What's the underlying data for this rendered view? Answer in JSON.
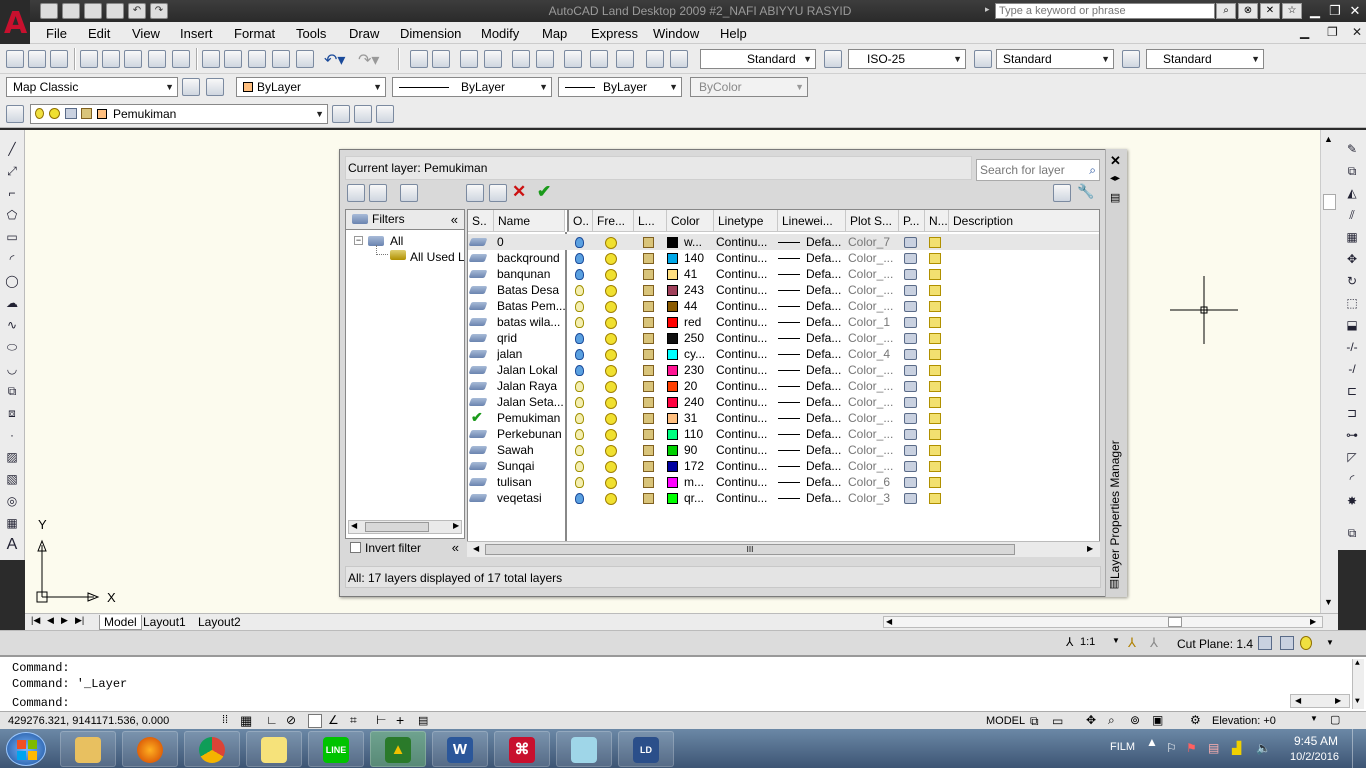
{
  "window": {
    "title": "AutoCAD Land Desktop 2009 #2_NAFI ABIYYU RASYID",
    "search_placeholder": "Type a keyword or phrase"
  },
  "menu": [
    "File",
    "Edit",
    "View",
    "Insert",
    "Format",
    "Tools",
    "Draw",
    "Dimension",
    "Modify",
    "Map",
    "Express",
    "Window",
    "Help"
  ],
  "toolbar": {
    "text_style": "Standard",
    "dim_style": "ISO-25",
    "table_style": "Standard",
    "multileader_style": "Standard",
    "workspace": "Map Classic",
    "color": "ByLayer",
    "linetype": "ByLayer",
    "lineweight": "ByLayer",
    "plotstyle": "ByColor",
    "layer": "Pemukiman"
  },
  "layer_manager": {
    "current_layer": "Current layer: Pemukiman",
    "search_placeholder": "Search for layer",
    "side_title": "Layer Properties Manager",
    "filters_label": "Filters",
    "filter_tree": [
      "All",
      "All Used L"
    ],
    "invert_filter": "Invert filter",
    "columns": [
      "S..",
      "Name",
      "O..",
      "Fre...",
      "L...",
      "Color",
      "Linetype",
      "Linewei...",
      "Plot S...",
      "P...",
      "N...",
      "Description"
    ],
    "status": "All: 17 layers displayed of 17 total layers",
    "layers": [
      {
        "name": "0",
        "on": true,
        "color_hex": "#000000",
        "color_label": "w...",
        "linetype": "Continu...",
        "lineweight": "Defa...",
        "plot_style": "Color_7",
        "current": false
      },
      {
        "name": "backqround",
        "on": true,
        "color_hex": "#00a8e8",
        "color_label": "140",
        "linetype": "Continu...",
        "lineweight": "Defa...",
        "plot_style": "Color_...",
        "current": false
      },
      {
        "name": "banqunan",
        "on": true,
        "color_hex": "#ffdf80",
        "color_label": "41",
        "linetype": "Continu...",
        "lineweight": "Defa...",
        "plot_style": "Color_...",
        "current": false
      },
      {
        "name": "Batas Desa",
        "on": false,
        "color_hex": "#a0405a",
        "color_label": "243",
        "linetype": "Continu...",
        "lineweight": "Defa...",
        "plot_style": "Color_...",
        "current": false
      },
      {
        "name": "Batas Pem...",
        "on": false,
        "color_hex": "#8a5a00",
        "color_label": "44",
        "linetype": "Continu...",
        "lineweight": "Defa...",
        "plot_style": "Color_...",
        "current": false
      },
      {
        "name": "batas wila...",
        "on": false,
        "color_hex": "#ff0000",
        "color_label": "red",
        "linetype": "Continu...",
        "lineweight": "Defa...",
        "plot_style": "Color_1",
        "current": false
      },
      {
        "name": "qrid",
        "on": true,
        "color_hex": "#101010",
        "color_label": "250",
        "linetype": "Continu...",
        "lineweight": "Defa...",
        "plot_style": "Color_...",
        "current": false
      },
      {
        "name": "jalan",
        "on": true,
        "color_hex": "#00ffff",
        "color_label": "cy...",
        "linetype": "Continu...",
        "lineweight": "Defa...",
        "plot_style": "Color_4",
        "current": false
      },
      {
        "name": "Jalan Lokal",
        "on": true,
        "color_hex": "#ff1493",
        "color_label": "230",
        "linetype": "Continu...",
        "lineweight": "Defa...",
        "plot_style": "Color_...",
        "current": false
      },
      {
        "name": "Jalan Raya",
        "on": false,
        "color_hex": "#ff3f00",
        "color_label": "20",
        "linetype": "Continu...",
        "lineweight": "Defa...",
        "plot_style": "Color_...",
        "current": false
      },
      {
        "name": "Jalan Seta...",
        "on": false,
        "color_hex": "#ff0040",
        "color_label": "240",
        "linetype": "Continu...",
        "lineweight": "Defa...",
        "plot_style": "Color_...",
        "current": false
      },
      {
        "name": "Pemukiman",
        "on": false,
        "color_hex": "#ffbf7f",
        "color_label": "31",
        "linetype": "Continu...",
        "lineweight": "Defa...",
        "plot_style": "Color_...",
        "current": true
      },
      {
        "name": "Perkebunan",
        "on": false,
        "color_hex": "#00ff80",
        "color_label": "110",
        "linetype": "Continu...",
        "lineweight": "Defa...",
        "plot_style": "Color_...",
        "current": false
      },
      {
        "name": "Sawah",
        "on": false,
        "color_hex": "#00d000",
        "color_label": "90",
        "linetype": "Continu...",
        "lineweight": "Defa...",
        "plot_style": "Color_...",
        "current": false
      },
      {
        "name": "Sunqai",
        "on": false,
        "color_hex": "#0000a0",
        "color_label": "172",
        "linetype": "Continu...",
        "lineweight": "Defa...",
        "plot_style": "Color_...",
        "current": false
      },
      {
        "name": "tulisan",
        "on": false,
        "color_hex": "#ff00ff",
        "color_label": "m...",
        "linetype": "Continu...",
        "lineweight": "Defa...",
        "plot_style": "Color_6",
        "current": false
      },
      {
        "name": "veqetasi",
        "on": true,
        "color_hex": "#00ff00",
        "color_label": "qr...",
        "linetype": "Continu...",
        "lineweight": "Defa...",
        "plot_style": "Color_3",
        "current": false
      }
    ]
  },
  "axis": {
    "y": "Y",
    "x": "X"
  },
  "tabs": [
    "Model",
    "Layout1",
    "Layout2"
  ],
  "annotation": {
    "scale": "1:1",
    "cut_plane": "Cut Plane:  1.4"
  },
  "command": {
    "lines": [
      "Command:",
      "Command: '_Layer",
      "Command:"
    ]
  },
  "status": {
    "coords": "429276.321, 9141171.536, 0.000",
    "model": "MODEL",
    "elevation": "Elevation: +0"
  },
  "tray": {
    "film": "FILM",
    "time": "9:45 AM",
    "date": "10/2/2016"
  },
  "taskbar": [
    {
      "name": "start",
      "label": ""
    },
    {
      "name": "explorer",
      "label": ""
    },
    {
      "name": "firefox",
      "label": ""
    },
    {
      "name": "chrome",
      "label": ""
    },
    {
      "name": "sticky-notes",
      "label": ""
    },
    {
      "name": "line",
      "label": "LINE"
    },
    {
      "name": "autocad",
      "label": ""
    },
    {
      "name": "word",
      "label": "W"
    },
    {
      "name": "acrobat",
      "label": ""
    },
    {
      "name": "folder-app",
      "label": ""
    },
    {
      "name": "land-desktop",
      "label": "LD"
    }
  ],
  "colors": {
    "accent": "#c8102e",
    "drawing_bg": "#fcfbee",
    "check": "#1a9a1a",
    "delete": "#cc1111"
  }
}
